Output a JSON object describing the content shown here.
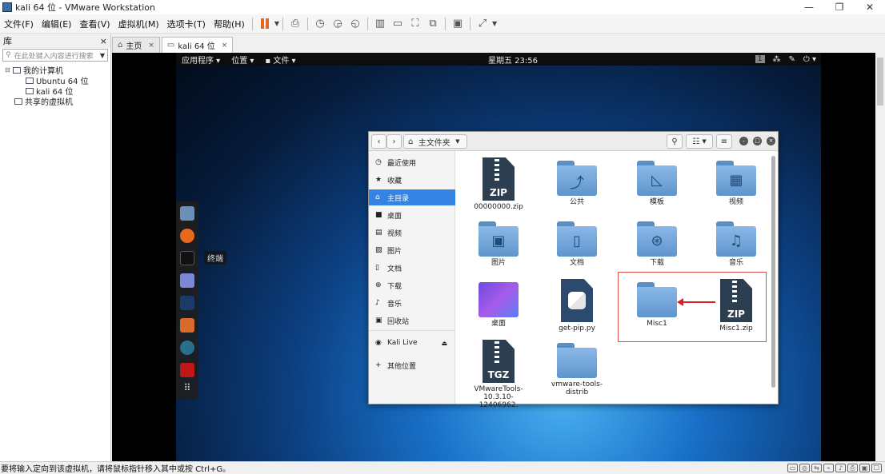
{
  "window": {
    "title": "kali 64 位 - VMware Workstation",
    "controls": [
      "—",
      "❐",
      "✕"
    ]
  },
  "menubar": {
    "items": [
      "文件(F)",
      "编辑(E)",
      "查看(V)",
      "虚拟机(M)",
      "选项卡(T)",
      "帮助(H)"
    ]
  },
  "library": {
    "title": "库",
    "close": "×",
    "search_placeholder": "在此处键入内容进行搜索",
    "tree": {
      "root": "我的计算机",
      "vm1": "Ubuntu 64 位",
      "vm2": "kali 64 位",
      "shared": "共享的虚拟机"
    }
  },
  "tabs": [
    {
      "label": "主页",
      "close": "×"
    },
    {
      "label": "kali 64 位",
      "close": "×"
    }
  ],
  "gnome": {
    "apps": "应用程序",
    "places": "位置",
    "files": "文件",
    "clock": "星期五 23:56",
    "workspace": "1"
  },
  "dock": {
    "tooltip": "终端"
  },
  "file_manager": {
    "path_label": "主文件夹",
    "sidebar": {
      "recent": "最近使用",
      "starred": "收藏",
      "home": "主目录",
      "desktop": "桌面",
      "videos": "视频",
      "pictures": "图片",
      "documents": "文档",
      "downloads": "下载",
      "music": "音乐",
      "trash": "回收站",
      "kali_live": "Kali Live",
      "other": "其他位置"
    },
    "files": {
      "zip0": "00000000.zip",
      "public": "公共",
      "templates": "模板",
      "videos": "视频",
      "pictures": "图片",
      "documents": "文档",
      "downloads": "下载",
      "music": "音乐",
      "desktop": "桌面",
      "getpip": "get-pip.py",
      "misc1": "Misc1",
      "misc1zip": "Misc1.zip",
      "vmtools": "VMwareTools-10.3.10-12406962.",
      "vmtools_distrib": "vmware-tools-distrib"
    },
    "ext_zip": "ZIP",
    "ext_tgz": "TGZ"
  },
  "status": {
    "message": "要将输入定向到该虚拟机，请将鼠标指针移入其中或按 Ctrl+G。"
  },
  "colors": {
    "highlight": "#3584e4",
    "annotation": "#e02020"
  }
}
